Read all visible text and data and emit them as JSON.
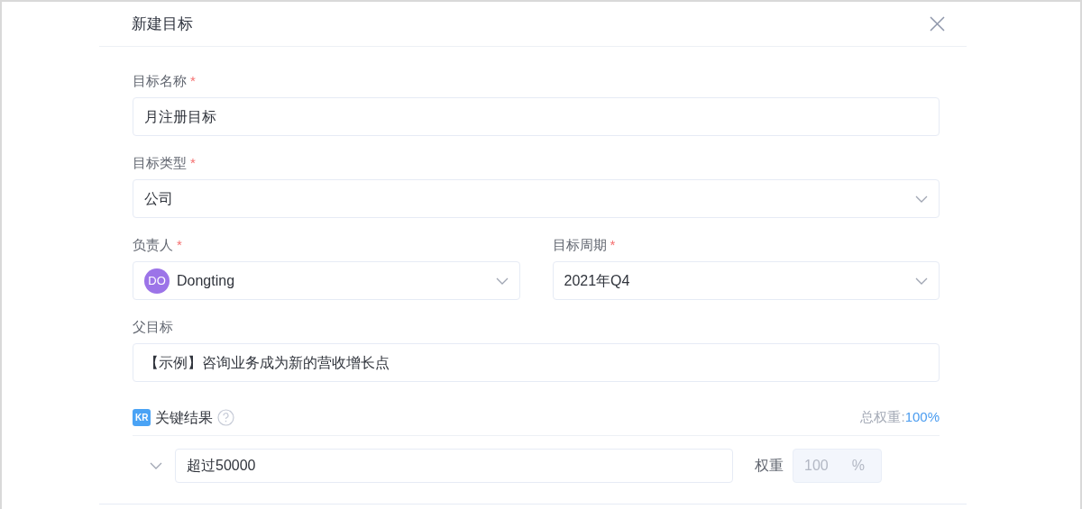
{
  "dialog": {
    "title": "新建目标"
  },
  "fields": [
    {
      "kind": "text",
      "label": "目标名称",
      "required_mark": "*",
      "value": "月注册目标"
    },
    {
      "kind": "select",
      "label": "目标类型",
      "required_mark": "*",
      "value": "公司"
    },
    {
      "kind": "user",
      "label": "负责人",
      "required_mark": "*",
      "avatar": "DO",
      "value": "Dongting"
    },
    {
      "kind": "select",
      "label": "目标周期",
      "required_mark": "*",
      "value": "2021年Q4"
    },
    {
      "kind": "text",
      "label": "父目标",
      "value": "【示例】咨询业务成为新的营收增长点"
    }
  ],
  "key_results": {
    "badge": "KR",
    "title": "关键结果",
    "total_label": "总权重:",
    "total_value": "100%",
    "rows": [
      {
        "expanded": false,
        "value": "超过50000",
        "weight_label": "权重",
        "weight": "100",
        "unit": "%",
        "weight_disabled": true
      }
    ]
  }
}
